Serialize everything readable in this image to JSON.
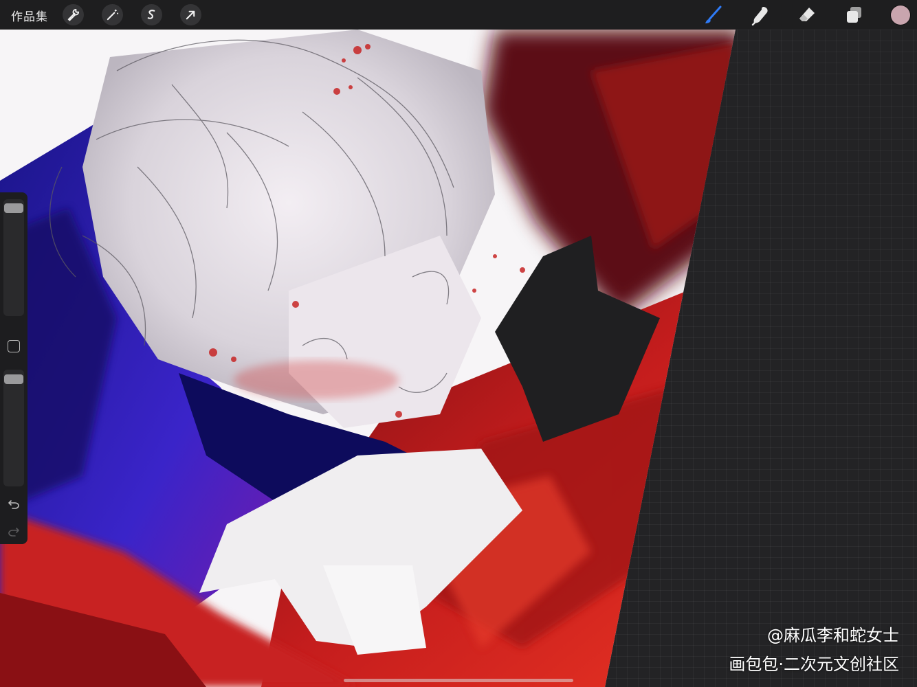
{
  "app": {
    "gallery_label": "作品集"
  },
  "toolbar": {
    "left_tools": [
      {
        "name": "wrench-icon"
      },
      {
        "name": "magic-wand-icon"
      },
      {
        "name": "selection-icon"
      },
      {
        "name": "transform-arrow-icon"
      }
    ],
    "right_tools": [
      {
        "name": "brush-icon",
        "active": true
      },
      {
        "name": "smudge-icon"
      },
      {
        "name": "eraser-icon"
      },
      {
        "name": "layers-icon"
      }
    ],
    "current_color": "#c9a5ae",
    "active_tool_color": "#2f7bf6"
  },
  "sidebar": {
    "brush_size": 0.95,
    "opacity": 0.96,
    "icons": [
      "modify-button",
      "undo-icon",
      "redo-icon"
    ]
  },
  "watermark": {
    "line1": "@麻瓜李和蛇女士",
    "line2": "画包包·二次元文创社区"
  },
  "colors": {
    "toolbar_bg": "#1e1e1f",
    "workspace_bg": "#232325",
    "accent_red": "#c81c1c",
    "accent_blue": "#2a1fb8"
  }
}
